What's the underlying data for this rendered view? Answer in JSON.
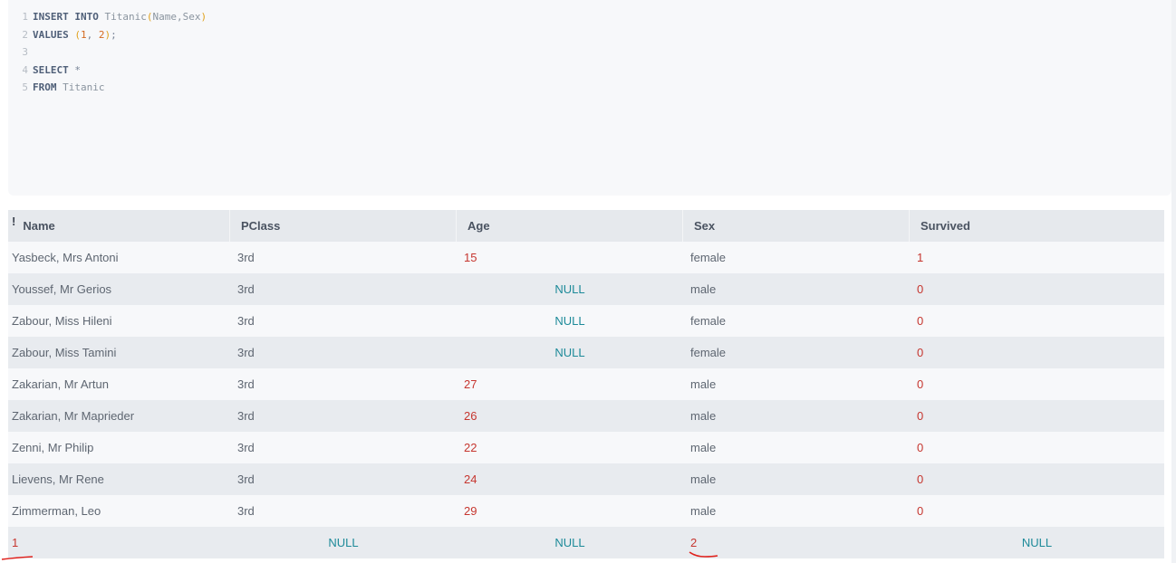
{
  "editor": {
    "lines": [
      {
        "num": "1",
        "tokens": [
          {
            "t": "INSERT INTO",
            "k": "kw"
          },
          {
            "t": " Titanic",
            "k": "tx"
          },
          {
            "t": "(",
            "k": "pn"
          },
          {
            "t": "Name",
            "k": "tx"
          },
          {
            "t": ",",
            "k": "tx"
          },
          {
            "t": "Sex",
            "k": "tx"
          },
          {
            "t": ")",
            "k": "pn"
          }
        ]
      },
      {
        "num": "2",
        "tokens": [
          {
            "t": "VALUES",
            "k": "kw"
          },
          {
            "t": " ",
            "k": "tx"
          },
          {
            "t": "(",
            "k": "pn"
          },
          {
            "t": "1",
            "k": "num"
          },
          {
            "t": ", ",
            "k": "op"
          },
          {
            "t": "2",
            "k": "num"
          },
          {
            "t": ")",
            "k": "pn"
          },
          {
            "t": ";",
            "k": "op"
          }
        ]
      },
      {
        "num": "3",
        "tokens": []
      },
      {
        "num": "4",
        "tokens": [
          {
            "t": "SELECT",
            "k": "kw"
          },
          {
            "t": " *",
            "k": "op"
          }
        ]
      },
      {
        "num": "5",
        "tokens": [
          {
            "t": "FROM",
            "k": "kw"
          },
          {
            "t": " Titanic",
            "k": "tx"
          }
        ]
      }
    ]
  },
  "grid": {
    "header_marker": "!",
    "columns": [
      "Name",
      "PClass",
      "Age",
      "Sex",
      "Survived"
    ],
    "rows": [
      {
        "Name": "Yasbeck, Mrs Antoni",
        "PClass": "3rd",
        "Age": "15",
        "Sex": "female",
        "Survived": "1"
      },
      {
        "Name": "Youssef, Mr Gerios",
        "PClass": "3rd",
        "Age": "NULL",
        "Sex": "male",
        "Survived": "0"
      },
      {
        "Name": "Zabour, Miss Hileni",
        "PClass": "3rd",
        "Age": "NULL",
        "Sex": "female",
        "Survived": "0"
      },
      {
        "Name": "Zabour, Miss Tamini",
        "PClass": "3rd",
        "Age": "NULL",
        "Sex": "female",
        "Survived": "0"
      },
      {
        "Name": "Zakarian, Mr Artun",
        "PClass": "3rd",
        "Age": "27",
        "Sex": "male",
        "Survived": "0"
      },
      {
        "Name": "Zakarian, Mr Maprieder",
        "PClass": "3rd",
        "Age": "26",
        "Sex": "male",
        "Survived": "0"
      },
      {
        "Name": "Zenni, Mr Philip",
        "PClass": "3rd",
        "Age": "22",
        "Sex": "male",
        "Survived": "0"
      },
      {
        "Name": "Lievens, Mr Rene",
        "PClass": "3rd",
        "Age": "24",
        "Sex": "male",
        "Survived": "0"
      },
      {
        "Name": "Zimmerman, Leo",
        "PClass": "3rd",
        "Age": "29",
        "Sex": "male",
        "Survived": "0"
      },
      {
        "Name": "1",
        "PClass": "NULL",
        "Age": "NULL",
        "Sex": "2",
        "Survived": "NULL"
      }
    ]
  },
  "colors": {
    "number": "#c6362f",
    "null": "#1d8a99",
    "annotation": "#e0201b"
  }
}
